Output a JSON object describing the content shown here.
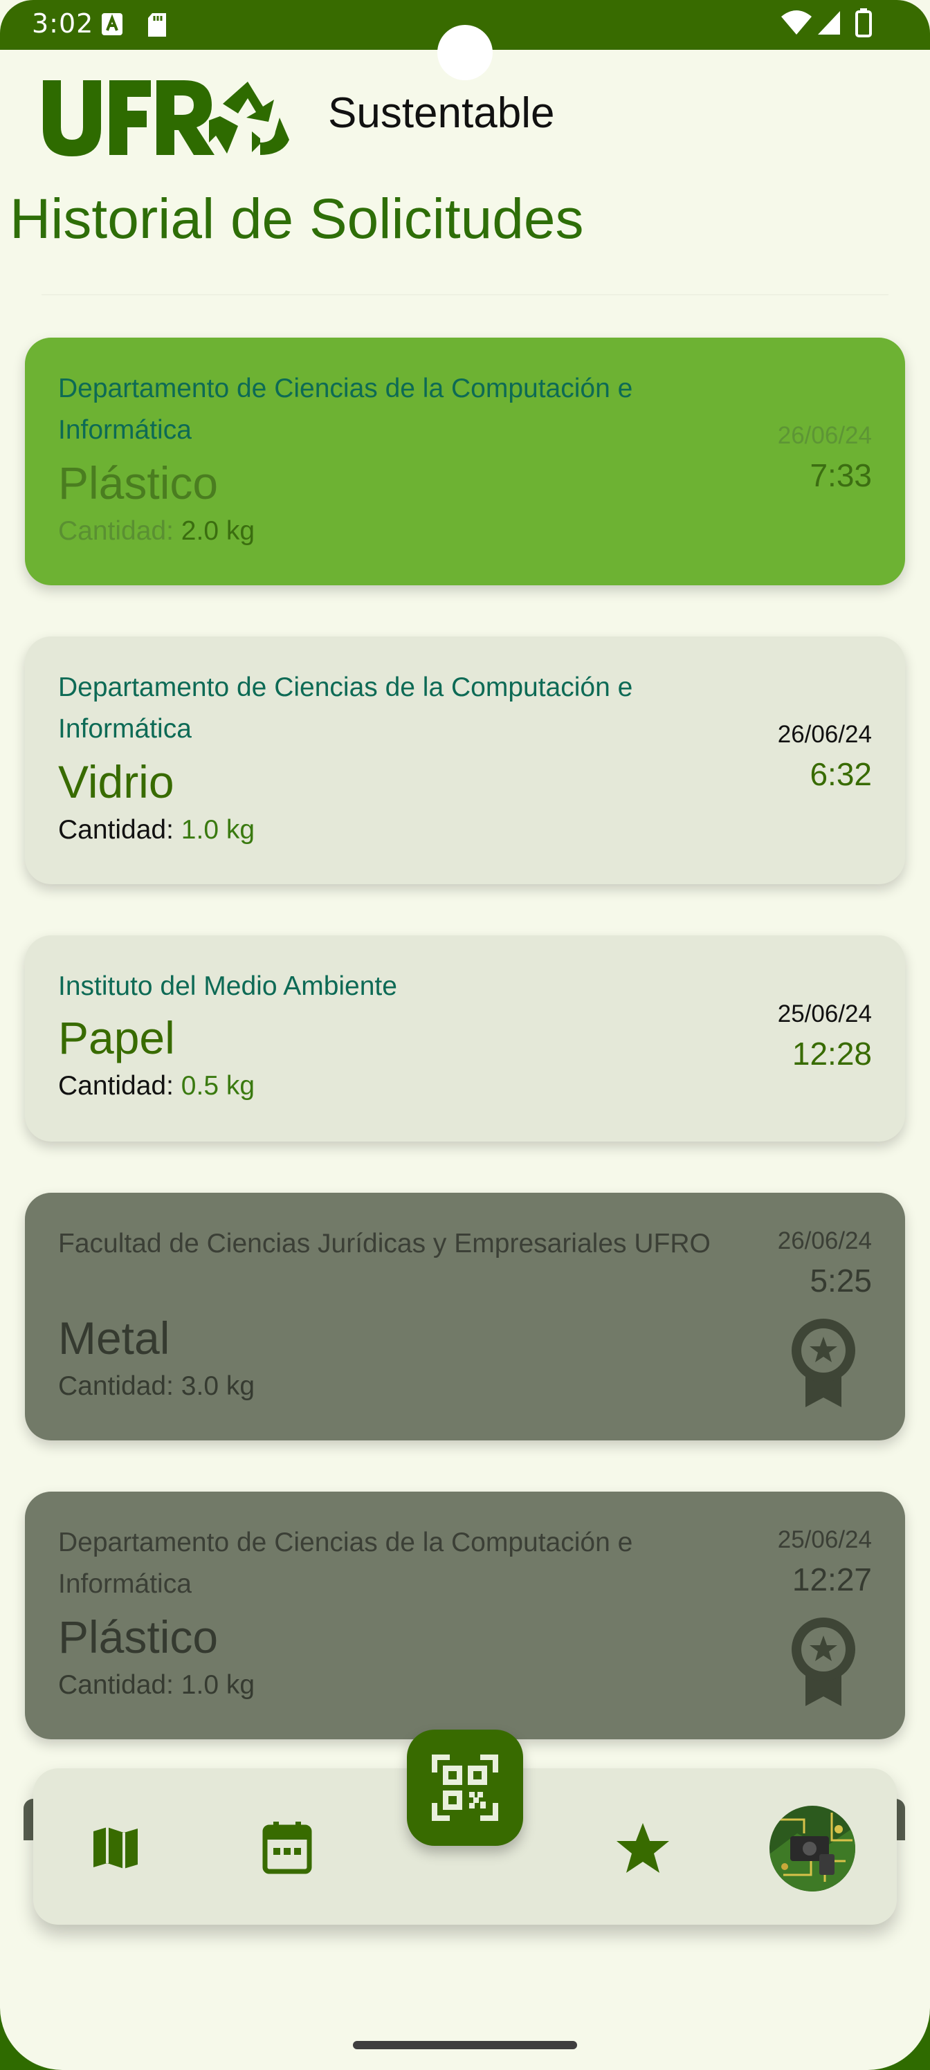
{
  "status_bar": {
    "time": "3:02"
  },
  "header": {
    "brand_text": "Sustentable",
    "page_title": "Historial de Solicitudes"
  },
  "cards": [
    {
      "department": "Departamento de Ciencias de la Computación e Informática",
      "material": "Plástico",
      "qty_label": "Cantidad:",
      "qty_value": "2.0 kg",
      "date": "26/06/24",
      "time": "7:33",
      "style": "green",
      "award": false
    },
    {
      "department": "Departamento de Ciencias de la Computación e Informática",
      "material": "Vidrio",
      "qty_label": "Cantidad:",
      "qty_value": "1.0 kg",
      "date": "26/06/24",
      "time": "6:32",
      "style": "light",
      "award": false
    },
    {
      "department": "Instituto del Medio Ambiente",
      "material": "Papel",
      "qty_label": "Cantidad:",
      "qty_value": "0.5 kg",
      "date": "25/06/24",
      "time": "12:28",
      "style": "light",
      "award": false
    },
    {
      "department": "Facultad de Ciencias Jurídicas y Empresariales UFRO",
      "material": "Metal",
      "qty_label": "Cantidad:",
      "qty_value": "3.0 kg",
      "date": "26/06/24",
      "time": "5:25",
      "style": "dark",
      "award": true
    },
    {
      "department": "Departamento de Ciencias de la Computación e Informática",
      "material": "Plástico",
      "qty_label": "Cantidad:",
      "qty_value": "1.0 kg",
      "date": "25/06/24",
      "time": "12:27",
      "style": "dark",
      "award": true
    }
  ],
  "bottom_nav": {
    "items": [
      {
        "icon": "map-icon"
      },
      {
        "icon": "calendar-icon"
      },
      {
        "icon": "qr-code-icon"
      },
      {
        "icon": "star-icon"
      },
      {
        "icon": "avatar"
      }
    ]
  },
  "colors": {
    "primary": "#386b00",
    "background": "#f6f9ea",
    "card_active": "#6db233",
    "card_default": "#e4e8d8",
    "card_done": "#727a68"
  }
}
